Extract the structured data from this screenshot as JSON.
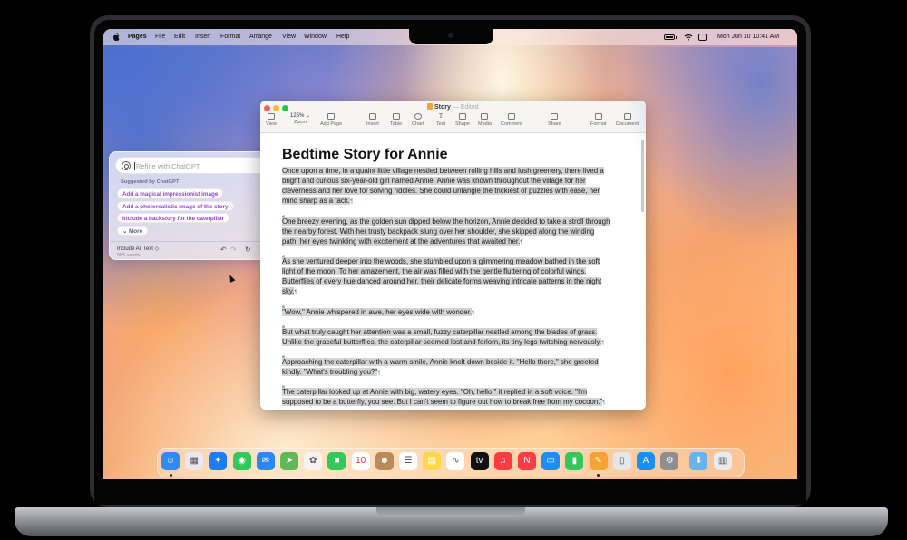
{
  "menubar": {
    "app": "Pages",
    "items": [
      "File",
      "Edit",
      "Insert",
      "Format",
      "Arrange",
      "View",
      "Window",
      "Help"
    ],
    "datetime": "Mon Jun 10  10:41 AM",
    "icons": [
      "apple-icon",
      "battery-icon",
      "wifi-icon",
      "control-center-icon"
    ]
  },
  "window": {
    "title": "Story",
    "status": "Edited",
    "toolbar": {
      "view": "View",
      "zoom_value": "125%",
      "zoom": "Zoom",
      "add_page": "Add Page",
      "insert": "Insert",
      "table": "Table",
      "chart": "Chart",
      "text": "Text",
      "shape": "Shape",
      "media": "Media",
      "comment": "Comment",
      "share": "Share",
      "format": "Format",
      "document": "Document"
    },
    "document": {
      "heading": "Bedtime Story for Annie",
      "paragraphs": [
        {
          "lines": [
            "Once upon a time, in a quaint little village nestled between rolling hills and lush greenery, there lived a",
            "bright and curious six-year-old girl named Annie. Annie was known throughout the village for her",
            "cleverness and her love for solving riddles. She could untangle the trickiest of puzzles with ease, her",
            "mind sharp as a tack."
          ]
        },
        {
          "lines": [
            "One breezy evening, as the golden sun dipped below the horizon, Annie decided to take a stroll through",
            "the nearby forest. With her trusty backpack slung over her shoulder, she skipped along the winding",
            "path, her eyes twinkling with excitement at the adventures that awaited her."
          ]
        },
        {
          "lines": [
            "As she ventured deeper into the woods, she stumbled upon a glimmering meadow bathed in the soft",
            "light of the moon. To her amazement, the air was filled with the gentle fluttering of colorful wings.",
            "Butterflies of every hue danced around her, their delicate forms weaving intricate patterns in the night",
            "sky."
          ]
        },
        {
          "lines": [
            "\"Wow,\" Annie whispered in awe, her eyes wide with wonder."
          ]
        },
        {
          "lines": [
            "But what truly caught her attention was a small, fuzzy caterpillar nestled among the blades of grass.",
            "Unlike the graceful butterflies, the caterpillar seemed lost and forlorn, its tiny legs twitching nervously."
          ]
        },
        {
          "lines": [
            "Approaching the caterpillar with a warm smile, Annie knelt down beside it. \"Hello there,\" she greeted",
            "kindly. \"What's troubling you?\""
          ]
        },
        {
          "lines": [
            "The caterpillar looked up at Annie with big, watery eyes. \"Oh, hello,\" it replied in a soft voice. \"I'm",
            "supposed to be a butterfly, you see. But I can't seem to figure out how to break free from my cocoon.\""
          ]
        }
      ],
      "pilcrow": "¶"
    }
  },
  "writing_tools": {
    "placeholder": "Refine with ChatGPT",
    "suggested_header": "Suggested by ChatGPT",
    "suggestions": [
      "Add a magical impressionist image",
      "Add a photorealistic image of the story",
      "Include a backstory for the caterpillar"
    ],
    "more": "More",
    "include": "Include All Text ◇",
    "word_count": "585 words",
    "undo": "↶",
    "redo": "↷",
    "refresh": "↻",
    "add": "⊕",
    "more_chevron": "⌄"
  },
  "dock": {
    "apps": [
      {
        "name": "finder",
        "glyph": "☺",
        "color": "#2f8cf2",
        "running": true
      },
      {
        "name": "launchpad",
        "glyph": "▦",
        "color": "#e8e8ee",
        "running": false
      },
      {
        "name": "safari",
        "glyph": "✦",
        "color": "#1c7df0",
        "running": false
      },
      {
        "name": "messages",
        "glyph": "◉",
        "color": "#34c759",
        "running": false
      },
      {
        "name": "mail",
        "glyph": "✉",
        "color": "#2b87f5",
        "running": false
      },
      {
        "name": "maps",
        "glyph": "➤",
        "color": "#5fb85a",
        "running": false
      },
      {
        "name": "photos",
        "glyph": "✿",
        "color": "#f6f2f0",
        "running": false
      },
      {
        "name": "facetime",
        "glyph": "■",
        "color": "#34c759",
        "running": false
      },
      {
        "name": "calendar",
        "glyph": "10",
        "color": "#ffffff",
        "running": false
      },
      {
        "name": "contacts",
        "glyph": "☻",
        "color": "#b98a5a",
        "running": false
      },
      {
        "name": "reminders",
        "glyph": "☰",
        "color": "#ffffff",
        "running": false
      },
      {
        "name": "notes",
        "glyph": "▤",
        "color": "#ffd84a",
        "running": false
      },
      {
        "name": "freeform",
        "glyph": "∿",
        "color": "#ffffff",
        "running": false
      },
      {
        "name": "tv",
        "glyph": "tv",
        "color": "#111111",
        "running": false
      },
      {
        "name": "music",
        "glyph": "♫",
        "color": "#fc3c44",
        "running": false
      },
      {
        "name": "news",
        "glyph": "N",
        "color": "#fc3c44",
        "running": false
      },
      {
        "name": "keynote",
        "glyph": "▭",
        "color": "#1f8cf0",
        "running": false
      },
      {
        "name": "numbers",
        "glyph": "▮",
        "color": "#35c759",
        "running": false
      },
      {
        "name": "pages",
        "glyph": "✎",
        "color": "#f7a234",
        "running": true
      },
      {
        "name": "iphone-mirroring",
        "glyph": "▯",
        "color": "#e4e6ea",
        "running": false
      },
      {
        "name": "app-store",
        "glyph": "A",
        "color": "#1b8ef5",
        "running": false
      },
      {
        "name": "system-settings",
        "glyph": "⚙",
        "color": "#8e8e93",
        "running": false
      },
      {
        "name": "downloads-folder",
        "glyph": "⬇",
        "color": "#69b3ec",
        "running": false
      },
      {
        "name": "trash",
        "glyph": "▥",
        "color": "#e8ecf0",
        "running": false
      }
    ]
  }
}
